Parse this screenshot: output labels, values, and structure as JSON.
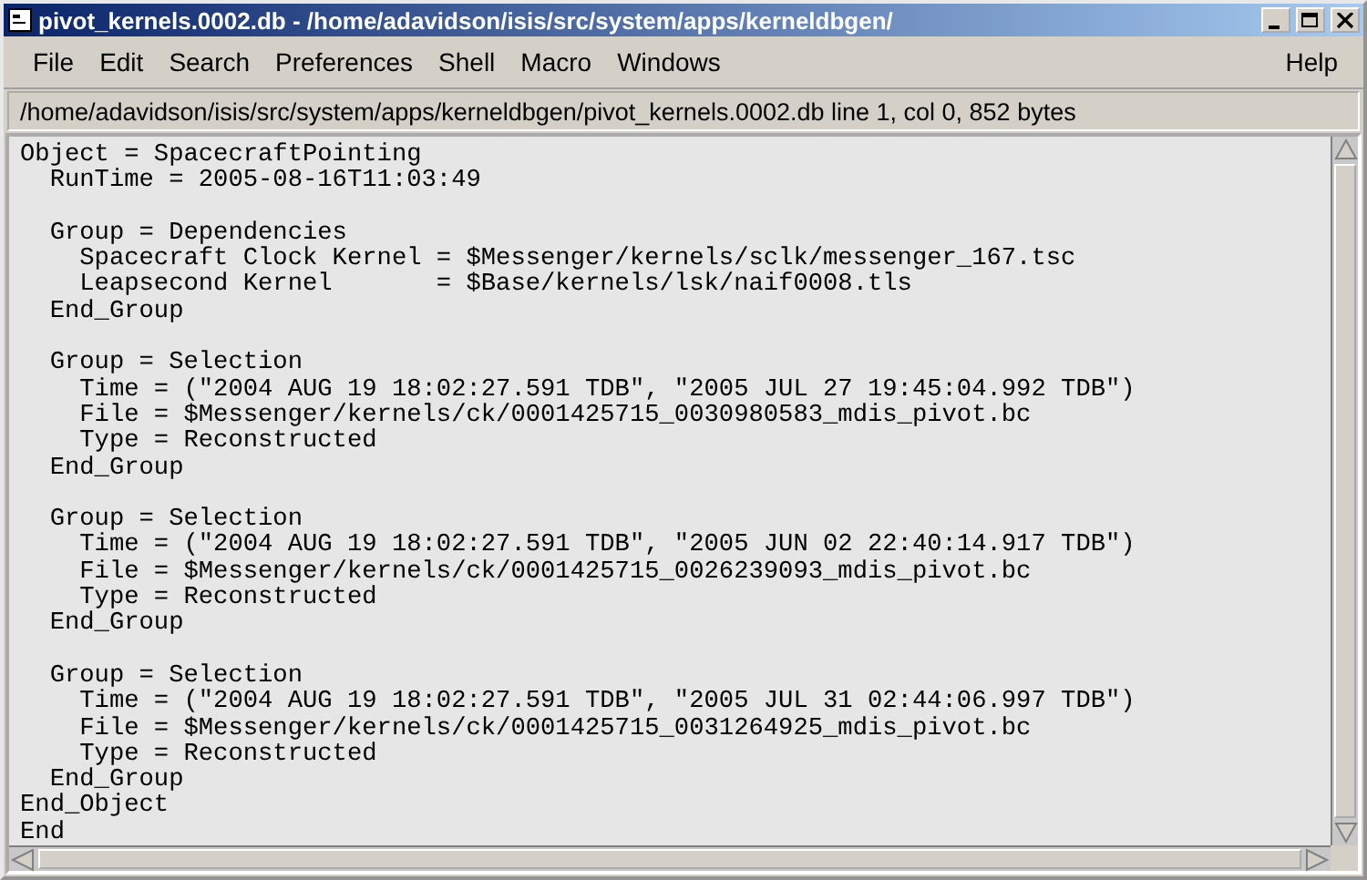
{
  "window": {
    "title": "pivot_kernels.0002.db - /home/adavidson/isis/src/system/apps/kerneldbgen/"
  },
  "menu": {
    "left": [
      "File",
      "Edit",
      "Search",
      "Preferences",
      "Shell",
      "Macro",
      "Windows"
    ],
    "right": [
      "Help"
    ]
  },
  "status": "/home/adavidson/isis/src/system/apps/kerneldbgen/pivot_kernels.0002.db line 1, col 0, 852 bytes",
  "editor": {
    "blocks": [
      [
        "Object = SpacecraftPointing",
        "  RunTime = 2005-08-16T11:03:49"
      ],
      [
        "  Group = Dependencies",
        "    Spacecraft Clock Kernel = $Messenger/kernels/sclk/messenger_167.tsc",
        "    Leapsecond Kernel       = $Base/kernels/lsk/naif0008.tls",
        "  End_Group"
      ],
      [
        "  Group = Selection",
        "    Time = (\"2004 AUG 19 18:02:27.591 TDB\", \"2005 JUL 27 19:45:04.992 TDB\")",
        "    File = $Messenger/kernels/ck/0001425715_0030980583_mdis_pivot.bc",
        "    Type = Reconstructed",
        "  End_Group"
      ],
      [
        "  Group = Selection",
        "    Time = (\"2004 AUG 19 18:02:27.591 TDB\", \"2005 JUN 02 22:40:14.917 TDB\")",
        "    File = $Messenger/kernels/ck/0001425715_0026239093_mdis_pivot.bc",
        "    Type = Reconstructed",
        "  End_Group"
      ],
      [
        "  Group = Selection",
        "    Time = (\"2004 AUG 19 18:02:27.591 TDB\", \"2005 JUL 31 02:44:06.997 TDB\")",
        "    File = $Messenger/kernels/ck/0001425715_0031264925_mdis_pivot.bc",
        "    Type = Reconstructed",
        "  End_Group",
        "End_Object",
        "End"
      ]
    ]
  }
}
